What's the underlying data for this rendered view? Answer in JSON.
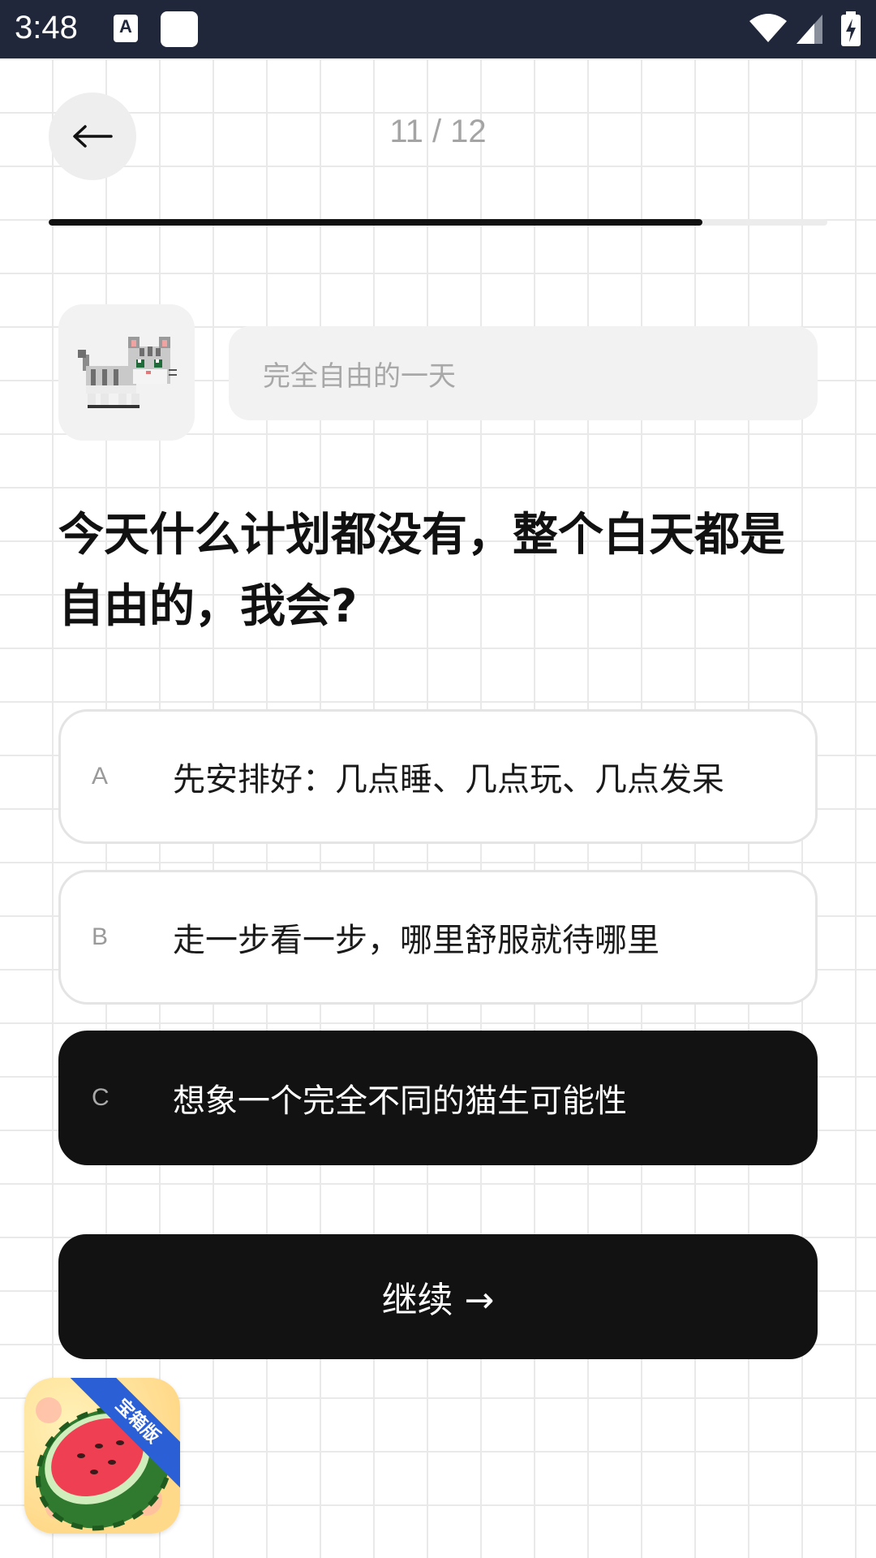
{
  "status_bar": {
    "time": "3:48",
    "icons": [
      "a-notification-icon",
      "app-notification-icon",
      "wifi-icon",
      "cell-signal-icon",
      "battery-charging-icon"
    ]
  },
  "header": {
    "back_icon": "arrow-left-icon",
    "progress_label": "11 / 12",
    "progress_fraction": 0.84
  },
  "avatar": {
    "icon": "pixel-cat-icon"
  },
  "subtitle": "完全自由的一天",
  "question": "今天什么计划都没有，整个白天都是自由的，我会?",
  "options": [
    {
      "key": "A",
      "text": "先安排好：几点睡、几点玩、几点发呆",
      "selected": false
    },
    {
      "key": "B",
      "text": "走一步看一步，哪里舒服就待哪里",
      "selected": false
    },
    {
      "key": "C",
      "text": "想象一个完全不同的猫生可能性",
      "selected": true
    }
  ],
  "continue_label": "继续 →",
  "floating_app": {
    "badge": "宝箱版",
    "icon": "watermelon-icon"
  },
  "colors": {
    "accent": "#121212",
    "status_bar": "#21273a",
    "muted_text": "#a4a4a4",
    "grid_line": "#e9e9e9",
    "badge_blue": "#2b5fd6"
  }
}
